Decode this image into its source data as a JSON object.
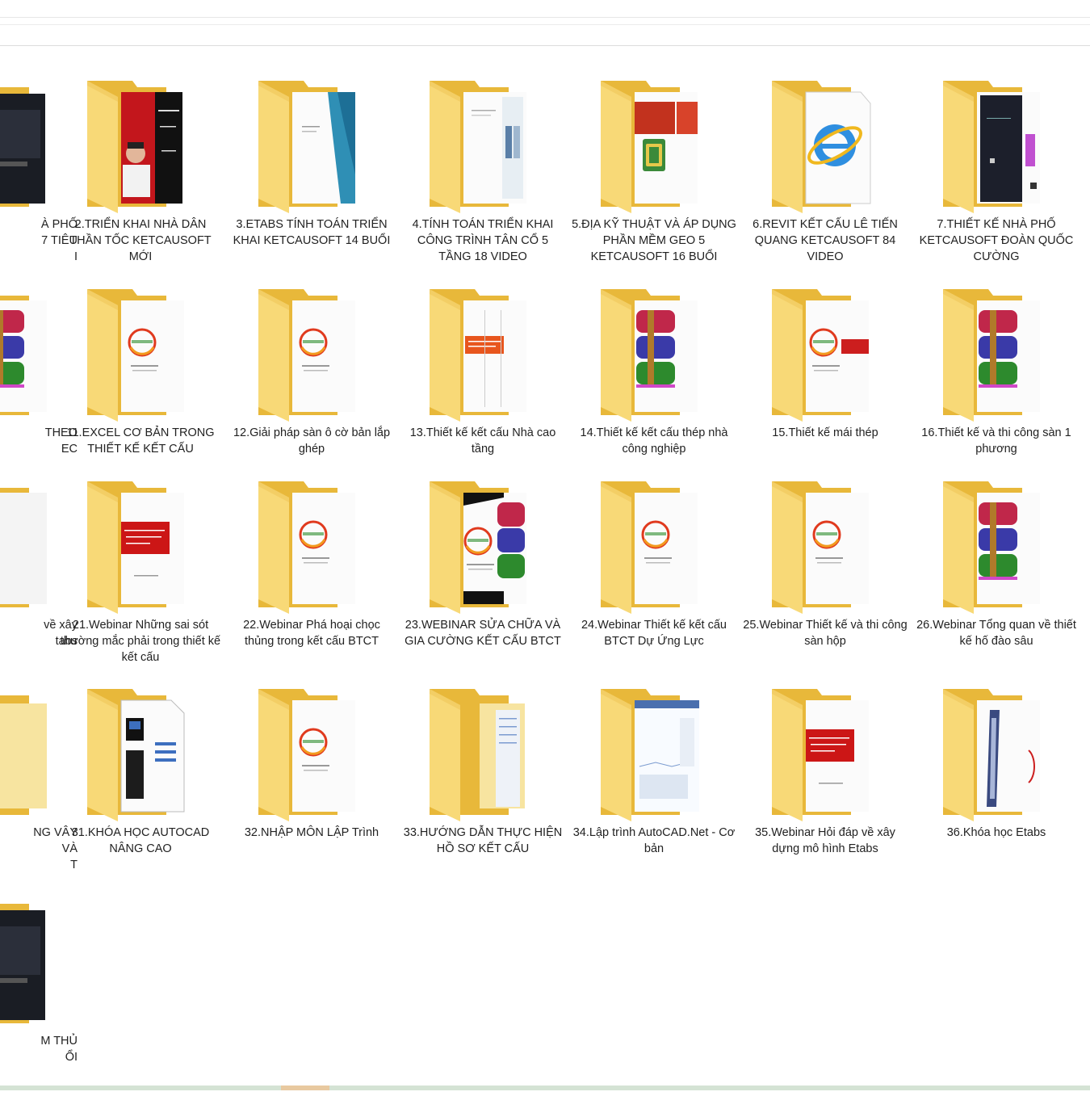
{
  "colors": {
    "folder_back": "#e8b83a",
    "folder_front": "#f8d977",
    "folder_tab": "#f0c75a",
    "paper": "#fafafa",
    "ketcausoft_red": "#e03a1e",
    "ketcausoft_orange": "#f29a1e"
  },
  "items": [
    {
      "label": "À PHỐ\n7 TIÊU\nI",
      "icon": "folder-dark-thumb-icon",
      "thumb": "dark"
    },
    {
      "label": "2.TRIỂN KHAI NHÀ DÂN THẦN TỐC KETCAUSOFT MỚI",
      "icon": "folder-video-thumb-icon",
      "thumb": "redvideo"
    },
    {
      "label": "3.ETABS TÍNH TOÁN TRIỂN KHAI KETCAUSOFT 14 BUỔI",
      "icon": "folder-sea-thumb-icon",
      "thumb": "sea"
    },
    {
      "label": "4.TÍNH TOÁN TRIỂN KHAI CÔNG TRÌNH TÂN CỔ 5 TẦNG 18 VIDEO",
      "icon": "folder-doc-thumb-icon",
      "thumb": "doc"
    },
    {
      "label": "5.ĐỊA KỸ THUẬT VÀ ÁP DỤNG PHẦN MỀM GEO 5 KETCAUSOFT 16 BUỔI",
      "icon": "folder-geo-thumb-icon",
      "thumb": "geo"
    },
    {
      "label": "6.REVIT KẾT CẤU LÊ TIẾN QUANG KETCAUSOFT 84 VIDEO",
      "icon": "folder-ie-thumb-icon",
      "thumb": "ie"
    },
    {
      "label": "7.THIẾT KẾ NHÀ PHỐ KETCAUSOFT ĐOÀN QUỐC CƯỜNG",
      "icon": "folder-cad-thumb-icon",
      "thumb": "cad"
    },
    {
      "label": "THEO\nEC",
      "icon": "folder-winrar-thumb-icon",
      "thumb": "rar"
    },
    {
      "label": "11.EXCEL CƠ BẢN TRONG THIẾT KẾ KẾT CẤU",
      "icon": "folder-ketcausoft-thumb-icon",
      "thumb": "logo"
    },
    {
      "label": "12.Giải pháp sàn ô cờ bản lắp ghép",
      "icon": "folder-ketcausoft-thumb-icon",
      "thumb": "logo"
    },
    {
      "label": "13.Thiết kế kết cấu Nhà cao tầng",
      "icon": "folder-orange-doc-thumb-icon",
      "thumb": "orangedoc"
    },
    {
      "label": "14.Thiết kế kết cấu thép nhà công nghiệp",
      "icon": "folder-winrar-thumb-icon",
      "thumb": "rar"
    },
    {
      "label": "15.Thiết kế mái thép",
      "icon": "folder-ketcausoft-thumb-icon",
      "thumb": "logored"
    },
    {
      "label": "16.Thiết kế và thi công sàn 1 phương",
      "icon": "folder-winrar-thumb-icon",
      "thumb": "rar"
    },
    {
      "label": "về xây\ntabs",
      "icon": "folder-doc-thumb-icon",
      "thumb": "blank"
    },
    {
      "label": "21.Webinar Những sai sót thường mắc phải trong thiết kế kết cấu",
      "icon": "folder-red-banner-thumb-icon",
      "thumb": "redbanner"
    },
    {
      "label": "22.Webinar Phá hoại chọc thủng trong kết cấu BTCT",
      "icon": "folder-ketcausoft-thumb-icon",
      "thumb": "logo"
    },
    {
      "label": "23.WEBINAR SỬA CHỮA VÀ GIA CƯỜNG KẾT CẤU BTCT",
      "icon": "folder-winrar-thumb-icon",
      "thumb": "rarlogo"
    },
    {
      "label": "24.Webinar Thiết kế kết cấu BTCT Dự Ứng Lực",
      "icon": "folder-ketcausoft-thumb-icon",
      "thumb": "logo"
    },
    {
      "label": "25.Webinar Thiết kế và thi công sàn hộp",
      "icon": "folder-ketcausoft-thumb-icon",
      "thumb": "logo"
    },
    {
      "label": "26.Webinar Tổng quan về thiết kế hố đào sâu",
      "icon": "folder-winrar-thumb-icon",
      "thumb": "rar"
    },
    {
      "label": "NG VÂY\nVÀ\nT",
      "icon": "folder-plain-icon",
      "thumb": "plain"
    },
    {
      "label": "31.KHÓA HỌC AUTOCAD NÂNG CAO",
      "icon": "folder-cad-doc-thumb-icon",
      "thumb": "caddoc"
    },
    {
      "label": "32.NHẬP MÔN LẬP Trình",
      "icon": "folder-ketcausoft-thumb-icon",
      "thumb": "logo"
    },
    {
      "label": "33.HƯỚNG DẪN THỰC HIỆN HỒ SƠ KẾT CẤU",
      "icon": "folder-files-thumb-icon",
      "thumb": "files"
    },
    {
      "label": "34.Lập trình AutoCAD.Net - Cơ bản",
      "icon": "folder-screenshot-thumb-icon",
      "thumb": "screenshot"
    },
    {
      "label": "35.Webinar Hỏi đáp về xây dựng mô hình Etabs",
      "icon": "folder-red-banner-thumb-icon",
      "thumb": "redbanner"
    },
    {
      "label": "36.Khóa học Etabs",
      "icon": "folder-etabs-thumb-icon",
      "thumb": "etabs"
    },
    {
      "label": "M THỦ\nỔI",
      "icon": "folder-dark-thumb-icon",
      "thumb": "dark"
    }
  ]
}
